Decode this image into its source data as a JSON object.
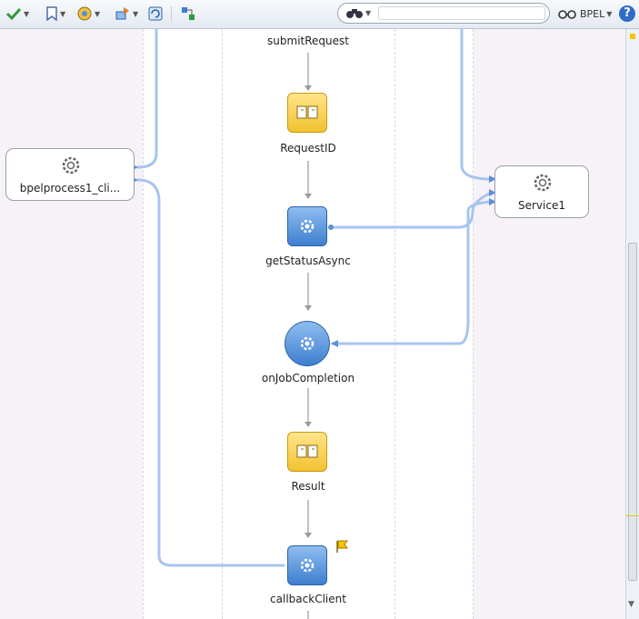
{
  "toolbar": {
    "items": [
      {
        "name": "validate-icon",
        "has_menu": true
      },
      {
        "name": "bookmark-icon",
        "has_menu": true
      },
      {
        "name": "settings-icon",
        "has_menu": true
      },
      {
        "name": "deploy-icon",
        "has_menu": true
      },
      {
        "name": "refresh-icon",
        "has_menu": false
      },
      {
        "name": "layout-icon",
        "has_menu": false
      }
    ],
    "search": {
      "icon": "binoculars-icon",
      "value": "",
      "placeholder": ""
    },
    "mode_label": "BPEL",
    "help_label": "?"
  },
  "process": {
    "activities": [
      {
        "label": "submitRequest",
        "type": "receive-label-only"
      },
      {
        "label": "RequestID",
        "type": "assign"
      },
      {
        "label": "getStatusAsync",
        "type": "invoke"
      },
      {
        "label": "onJobCompletion",
        "type": "receive"
      },
      {
        "label": "Result",
        "type": "assign"
      },
      {
        "label": "callbackClient",
        "type": "invoke",
        "flagged": true
      }
    ],
    "partner_links": {
      "left": {
        "label": "bpelprocess1_cli...",
        "icon": "gear-icon"
      },
      "right": {
        "label": "Service1",
        "icon": "gear-icon"
      }
    }
  },
  "colors": {
    "assign": "#f2c230",
    "invoke": "#3d7fcf",
    "connector": "#a8c4ef",
    "flag": "#f5c400"
  }
}
